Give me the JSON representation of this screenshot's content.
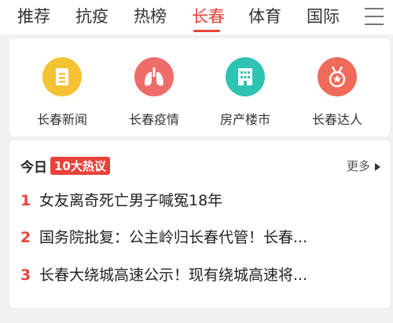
{
  "nav": {
    "tabs": [
      "推荐",
      "抗疫",
      "热榜",
      "长春",
      "体育",
      "国际"
    ],
    "active_tab": "长春",
    "accent_color": "#e8423a"
  },
  "services": [
    {
      "label": "长春新闻",
      "icon": "document-icon",
      "color": "#f5c234"
    },
    {
      "label": "长春疫情",
      "icon": "lungs-icon",
      "color": "#ee6c6a"
    },
    {
      "label": "房产楼市",
      "icon": "building-icon",
      "color": "#2ec3b3"
    },
    {
      "label": "长春达人",
      "icon": "medal-icon",
      "color": "#f06a5a"
    }
  ],
  "hot": {
    "today_label": "今日",
    "badge": "10大热议",
    "more_label": "更多",
    "items": [
      {
        "rank": "1",
        "text": "女友离奇死亡男子喊冤18年"
      },
      {
        "rank": "2",
        "text": "国务院批复：公主岭归长春代管！长春..."
      },
      {
        "rank": "3",
        "text": "长春大绕城高速公示！现有绕城高速将..."
      }
    ]
  }
}
